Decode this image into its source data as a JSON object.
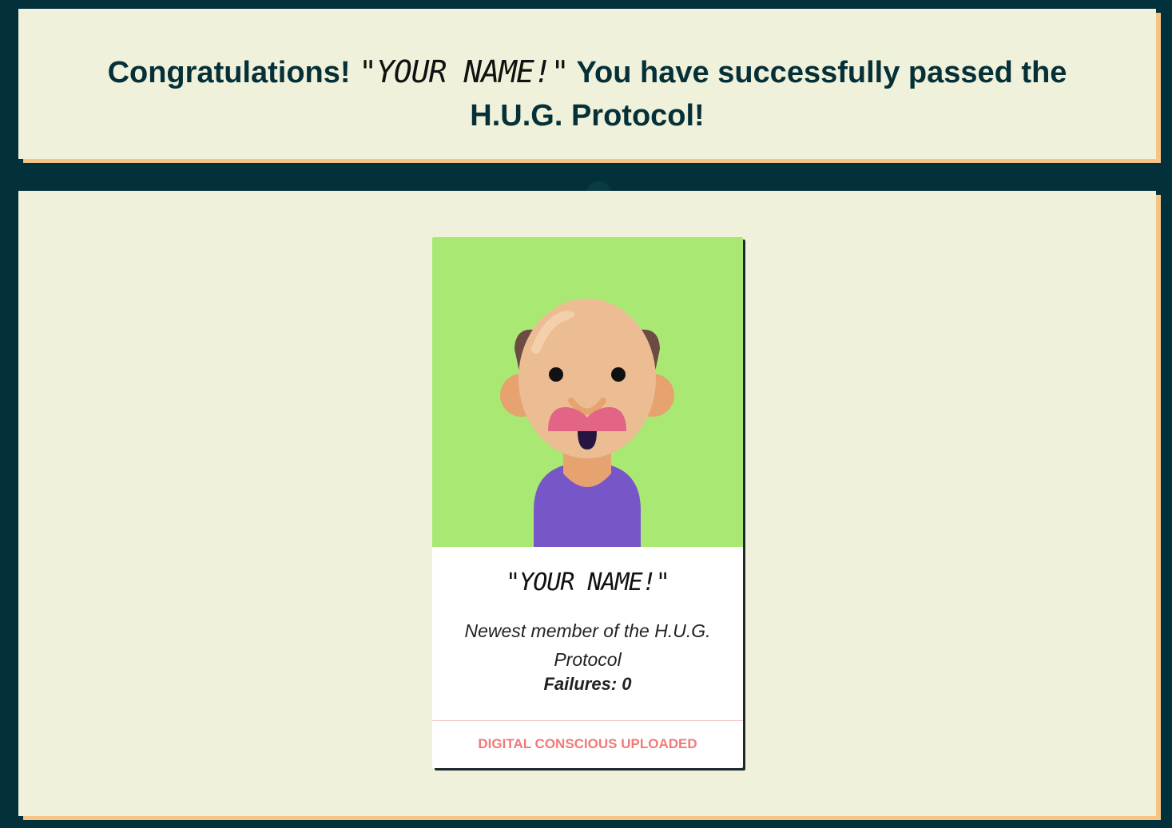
{
  "header": {
    "prefix": "Congratulations! ",
    "name": "\"YOUR NAME!\"",
    "suffix": " You have successfully passed the H.U.G. Protocol!"
  },
  "card": {
    "name": "\"YOUR NAME!\"",
    "description": "Newest member of the H.U.G. Protocol",
    "failures": "Failures: 0",
    "action_label": "DIGITAL CONSCIOUS UPLOADED",
    "avatar_icon": "bald-man-avatar-icon"
  },
  "colors": {
    "page_background": "#02303b",
    "panel_background": "#f0f1da",
    "panel_shadow": "#f6c485",
    "heading_text": "#053038",
    "avatar_background": "#a9e873",
    "action_text": "#f07a78"
  }
}
